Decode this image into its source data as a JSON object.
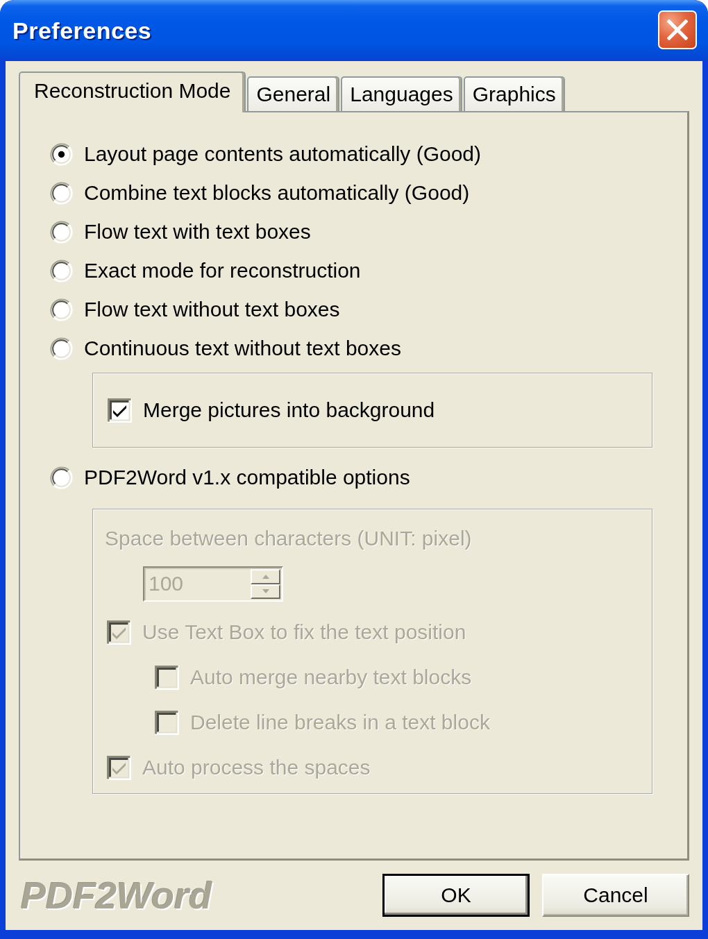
{
  "window": {
    "title": "Preferences"
  },
  "tabs": [
    {
      "label": "Reconstruction Mode",
      "selected": true
    },
    {
      "label": "General",
      "selected": false
    },
    {
      "label": "Languages",
      "selected": false
    },
    {
      "label": "Graphics",
      "selected": false
    }
  ],
  "modes": [
    {
      "label": "Layout page contents automatically (Good)",
      "selected": true
    },
    {
      "label": "Combine text blocks automatically (Good)",
      "selected": false
    },
    {
      "label": "Flow text with text boxes",
      "selected": false
    },
    {
      "label": "Exact mode for reconstruction",
      "selected": false
    },
    {
      "label": "Flow text without text boxes",
      "selected": false
    },
    {
      "label": "Continuous text without text boxes",
      "selected": false
    }
  ],
  "merge_group": {
    "options": [
      {
        "label": "Merge pictures into background",
        "checked": true
      }
    ]
  },
  "compat_mode": {
    "label": "PDF2Word v1.x compatible options",
    "selected": false
  },
  "compat_group": {
    "disabled": true,
    "spacing_label": "Space between characters (UNIT: pixel)",
    "spacing_value": "100",
    "options": [
      {
        "label": "Use Text Box to fix the text position",
        "checked": true,
        "children": [
          {
            "label": "Auto merge nearby text blocks",
            "checked": false
          },
          {
            "label": "Delete line breaks in a text block",
            "checked": false
          }
        ]
      },
      {
        "label": "Auto process the spaces",
        "checked": true
      }
    ]
  },
  "footer": {
    "logo": "PDF2Word",
    "buttons": [
      {
        "label": "OK",
        "default": true
      },
      {
        "label": "Cancel",
        "default": false
      }
    ]
  }
}
